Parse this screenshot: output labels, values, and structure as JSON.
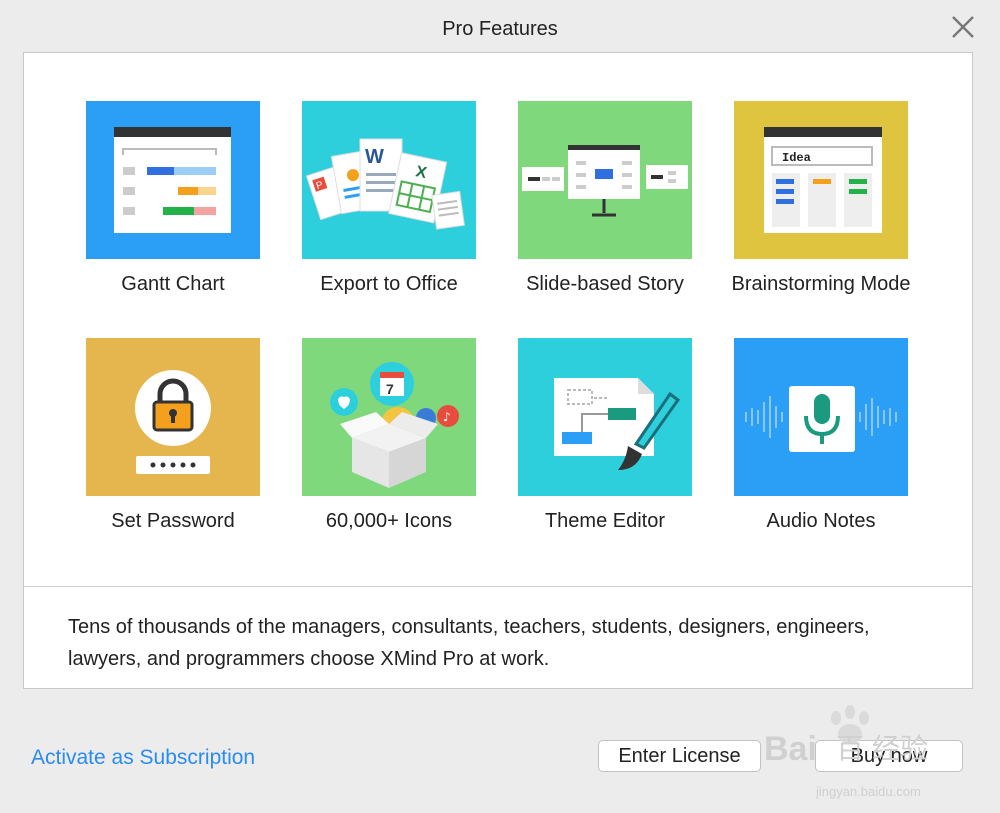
{
  "window": {
    "title": "Pro Features"
  },
  "features": [
    {
      "label": "Gantt Chart",
      "color": "#2b9ff5",
      "icon": "gantt-chart-icon"
    },
    {
      "label": "Export to Office",
      "color": "#2ecfdc",
      "icon": "office-documents-icon"
    },
    {
      "label": "Slide-based Story",
      "color": "#7fd87c",
      "icon": "presentation-board-icon"
    },
    {
      "label": "Brainstorming Mode",
      "color": "#dfc440",
      "icon": "brainstorm-board-icon"
    },
    {
      "label": "Set Password",
      "color": "#e5b54e",
      "icon": "padlock-icon"
    },
    {
      "label": "60,000+ Icons",
      "color": "#7fd87c",
      "icon": "icon-box-icon"
    },
    {
      "label": "Theme Editor",
      "color": "#2ecfdc",
      "icon": "paintbrush-icon"
    },
    {
      "label": "Audio Notes",
      "color": "#2b9ff5",
      "icon": "microphone-icon"
    }
  ],
  "brainstorm_card_text": "Idea",
  "description": "Tens of thousands of the managers, consultants, teachers, students, designers, engineers, lawyers, and programmers choose XMind Pro at work.",
  "footer": {
    "subscription_link": "Activate as Subscription",
    "enter_license": "Enter License",
    "buy_now": "Buy now"
  },
  "watermark": {
    "brand": "Bai",
    "brand2": "百",
    "domain": "jingyan.baidu.com",
    "caption": "经验"
  }
}
